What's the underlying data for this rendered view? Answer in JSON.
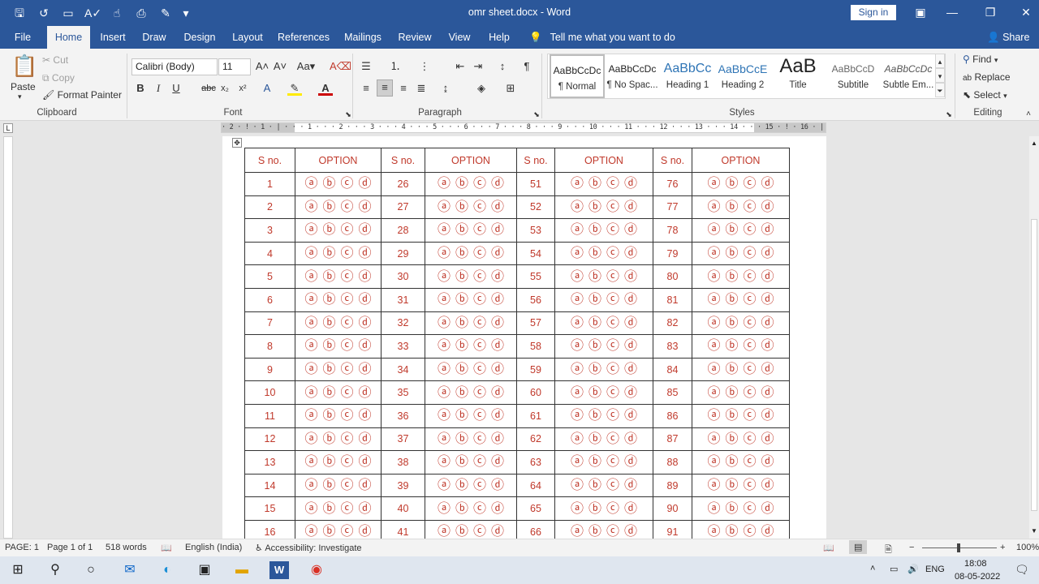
{
  "app": {
    "title": "omr sheet.docx  -  Word",
    "signin": "Sign in"
  },
  "qat": {
    "save_icon": "save-icon",
    "undo_icon": "undo-icon",
    "open_icon": "open-icon",
    "spelling_icon": "spelling-icon",
    "touch_icon": "touch-icon",
    "preview_icon": "print-preview-icon",
    "painter_icon": "format-painter-icon"
  },
  "tabs": [
    "File",
    "Home",
    "Insert",
    "Draw",
    "Design",
    "Layout",
    "References",
    "Mailings",
    "Review",
    "View",
    "Help"
  ],
  "tellme": "Tell me what you want to do",
  "share": "Share",
  "clipboard": {
    "paste": "Paste",
    "cut": "Cut",
    "copy": "Copy",
    "format_painter": "Format Painter",
    "label": "Clipboard"
  },
  "font": {
    "name": "Calibri (Body)",
    "size": "11",
    "label": "Font"
  },
  "paragraph": {
    "label": "Paragraph"
  },
  "styles": {
    "label": "Styles",
    "items": [
      {
        "preview": "AaBbCcDc",
        "name": "¶ Normal"
      },
      {
        "preview": "AaBbCcDc",
        "name": "¶ No Spac..."
      },
      {
        "preview": "AaBbCc",
        "name": "Heading 1"
      },
      {
        "preview": "AaBbCcE",
        "name": "Heading 2"
      },
      {
        "preview": "AaB",
        "name": "Title"
      },
      {
        "preview": "AaBbCcD",
        "name": "Subtitle"
      },
      {
        "preview": "AaBbCcDc",
        "name": "Subtle Em..."
      }
    ]
  },
  "editing": {
    "find": "Find",
    "replace": "Replace",
    "select": "Select",
    "label": "Editing"
  },
  "ruler": {
    "text": "· 2 · ! · 1 · | · · · 1 · · · 2 · · · 3 · · · 4 · · · 5 · · · 6 · · · 7 · · · 8 · · · 9 · · · 10 · · · 11 · · · 12 · · · 13 · · · 14 · · · 15 · ! · 16 · | · 17 · ! · 18 ·"
  },
  "table": {
    "sno_header": "S no.",
    "option_header": "OPTION",
    "bubbles": [
      "ⓐ",
      "ⓑ",
      "ⓒ",
      "ⓓ"
    ],
    "rows": [
      [
        "1",
        "26",
        "51",
        "76"
      ],
      [
        "2",
        "27",
        "52",
        "77"
      ],
      [
        "3",
        "28",
        "53",
        "78"
      ],
      [
        "4",
        "29",
        "54",
        "79"
      ],
      [
        "5",
        "30",
        "55",
        "80"
      ],
      [
        "6",
        "31",
        "56",
        "81"
      ],
      [
        "7",
        "32",
        "57",
        "82"
      ],
      [
        "8",
        "33",
        "58",
        "83"
      ],
      [
        "9",
        "34",
        "59",
        "84"
      ],
      [
        "10",
        "35",
        "60",
        "85"
      ],
      [
        "11",
        "36",
        "61",
        "86"
      ],
      [
        "12",
        "37",
        "62",
        "87"
      ],
      [
        "13",
        "38",
        "63",
        "88"
      ],
      [
        "14",
        "39",
        "64",
        "89"
      ],
      [
        "15",
        "40",
        "65",
        "90"
      ],
      [
        "16",
        "41",
        "66",
        "91"
      ]
    ]
  },
  "status": {
    "page": "PAGE: 1",
    "page_of": "Page 1 of 1",
    "words": "518 words",
    "language": "English (India)",
    "accessibility": "Accessibility: Investigate",
    "zoom": "100%"
  },
  "taskbar": {
    "lang": "ENG",
    "time": "18:08",
    "date": "08-05-2022"
  },
  "colors": {
    "word_blue": "#2b579a",
    "omr_red": "#c0392b"
  }
}
